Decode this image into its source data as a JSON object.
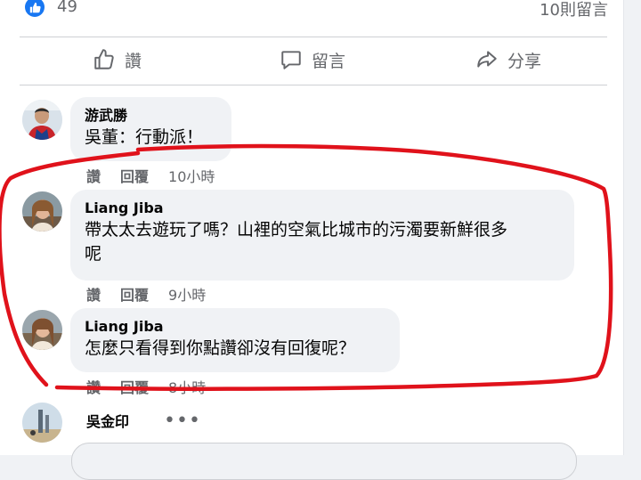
{
  "stats": {
    "like_count": "49",
    "comment_count": "10則留言"
  },
  "actions": {
    "like_label": "讚",
    "comment_label": "留言",
    "share_label": "分享"
  },
  "comments": [
    {
      "author": "游武勝",
      "text": "吳董：行動派！",
      "like_label": "讚",
      "reply_label": "回覆",
      "time": "10小時"
    },
    {
      "author": "Liang Jiba",
      "text_line1": "帶太太去遊玩了嗎？山裡的空氣比城市的污濁要新鮮很多",
      "text_line2": "呢",
      "like_label": "讚",
      "reply_label": "回覆",
      "time": "9小時"
    },
    {
      "author": "Liang Jiba",
      "text": "怎麼只看得到你點讚卻沒有回復呢？",
      "like_label": "讚",
      "reply_label": "回覆",
      "time": "8小時"
    },
    {
      "author": "吳金印"
    }
  ],
  "colors": {
    "accent": "#1877f2",
    "annotation": "#e0121b",
    "bubble": "#f0f2f5"
  }
}
